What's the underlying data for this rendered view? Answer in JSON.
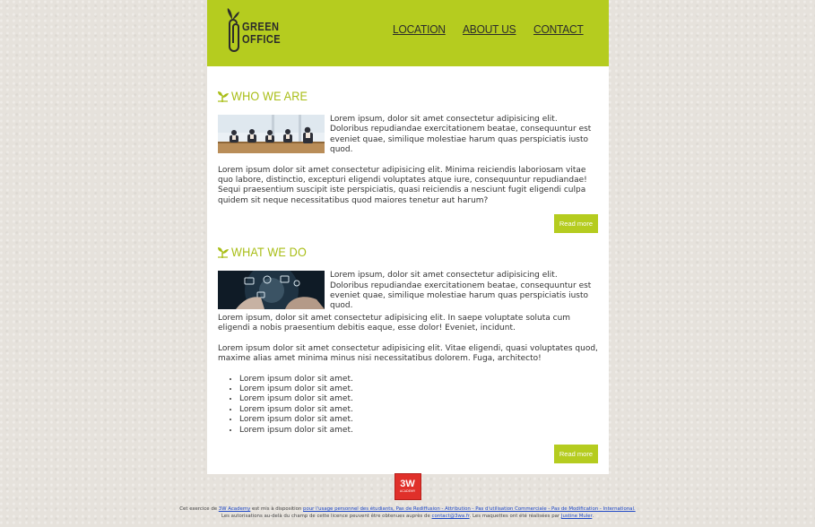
{
  "brand": {
    "line1": "GREEN",
    "line2": "OFFICE",
    "accent": "#b5cc1f"
  },
  "nav": {
    "location": "LOCATION",
    "about": "ABOUT US",
    "contact": "CONTACT"
  },
  "who": {
    "title": "WHO WE ARE",
    "intro": "Lorem ipsum, dolor sit amet consectetur adipisicing elit. Doloribus repudiandae exercitationem beatae, consequuntur est eveniet quae, similique molestiae harum quas perspiciatis iusto quod.",
    "body": "Lorem ipsum dolor sit amet consectetur adipisicing elit. Minima reiciendis laboriosam vitae quo labore, distinctio, excepturi eligendi voluptates atque iure, consequuntur repudiandae! Sequi praesentium suscipit iste perspiciatis, quasi reiciendis a nesciunt fugit eligendi culpa quidem sit neque necessitatibus quod maiores tenetur aut harum?",
    "button": "Read more"
  },
  "what": {
    "title": "WHAT WE DO",
    "intro": "Lorem ipsum, dolor sit amet consectetur adipisicing elit. Doloribus repudiandae exercitationem beatae, consequuntur est eveniet quae, similique molestiae harum quas perspiciatis iusto quod.",
    "body1": "Lorem ipsum, dolor sit amet consectetur adipisicing elit. In saepe voluptate soluta cum eligendi a nobis praesentium debitis eaque, esse dolor! Eveniet, incidunt.",
    "body2": "Lorem ipsum dolor sit amet consectetur adipisicing elit. Vitae eligendi, quasi voluptates quod, maxime alias amet minima minus nisi necessitatibus dolorem. Fuga, architecto!",
    "list": [
      "Lorem ipsum dolor sit amet.",
      "Lorem ipsum dolor sit amet.",
      "Lorem ipsum dolor sit amet.",
      "Lorem ipsum dolor sit amet.",
      "Lorem ipsum dolor sit amet.",
      "Lorem ipsum dolor sit amet."
    ],
    "button": "Read more"
  },
  "footer": {
    "badge_main": "3W",
    "badge_sub": "ACADEMY",
    "l1_a": "Cet exercice de ",
    "l1_link1": "3W Academy",
    "l1_b": " est mis à disposition ",
    "l1_link2": "pour l'usage personnel des étudiants, Pas de Rediffusion - Attribution - Pas d'utilisation Commerciale - Pas de Modification - International.",
    "l2_a": "Les autorisations au-delà du champ de cette licence peuvent être obtenues auprès de ",
    "l2_link1": "contact@3wa.fr",
    "l2_b": ". Les maquettes ont été réalisées par ",
    "l2_link2": "Justine Muler",
    "l2_c": "."
  }
}
